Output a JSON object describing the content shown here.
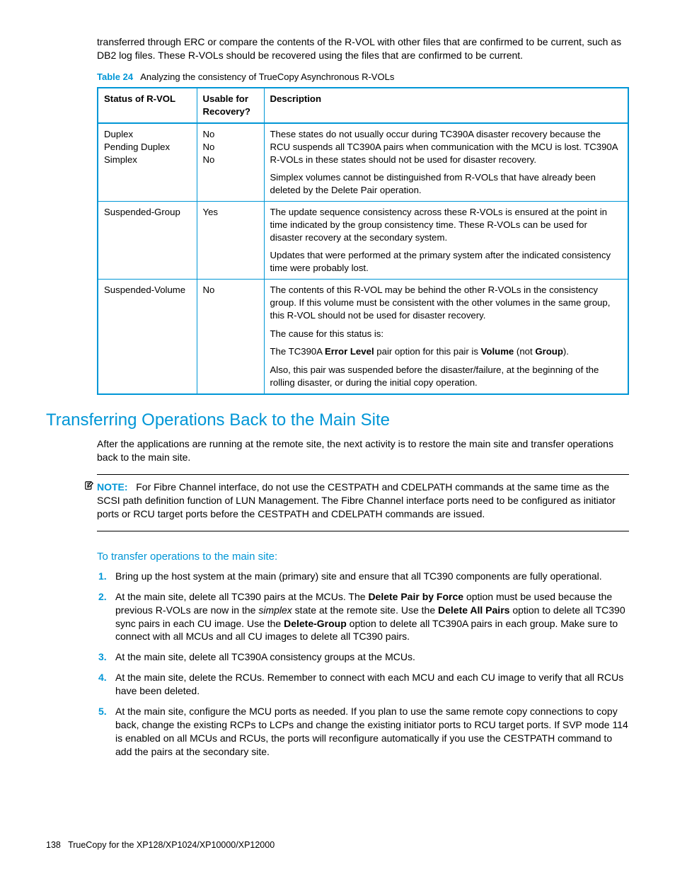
{
  "intro": "transferred through ERC or compare the contents of the R-VOL with other files that are confirmed to be current, such as DB2 log files. These R-VOLs should be recovered using the files that are confirmed to be current.",
  "table": {
    "caption_label": "Table 24",
    "caption_text": "Analyzing the consistency of TrueCopy Asynchronous R-VOLs",
    "headers": {
      "c1": "Status of R-VOL",
      "c2": "Usable for Recovery?",
      "c3": "Description"
    },
    "rows": [
      {
        "status": "Duplex\nPending Duplex\nSimplex",
        "usable": "No\nNo\nNo",
        "desc": [
          "These states do not usually occur during TC390A disaster recovery because the RCU suspends all TC390A pairs when communication with the MCU is lost. TC390A R-VOLs in these states should not be used for disaster recovery.",
          "Simplex volumes cannot be distinguished from R-VOLs that have already been deleted by the Delete Pair operation."
        ]
      },
      {
        "status": "Suspended-Group",
        "usable": "Yes",
        "desc": [
          "The update sequence consistency across these R-VOLs is ensured at the point in time indicated by the group consistency time. These R-VOLs can be used for disaster recovery at the secondary system.",
          "Updates that were performed at the primary system after the indicated consistency time were probably lost."
        ]
      },
      {
        "status": "Suspended-Volume",
        "usable": "No",
        "desc": [
          "The contents of this R-VOL may be behind the other R-VOLs in the consistency group. If this volume must be consistent with the other volumes in the same group, this R-VOL should not be used for disaster recovery.",
          "The cause for this status is:",
          "The TC390A <b>Error Level</b> pair option for this pair is <b>Volume</b> (not <b>Group</b>).",
          "Also, this pair was suspended before the disaster/failure, at the beginning of the rolling disaster, or during the initial copy operation."
        ]
      }
    ]
  },
  "section_heading": "Transferring Operations Back to the Main Site",
  "section_para": "After the applications are running at the remote site, the next activity is to restore the main site and transfer operations back to the main site.",
  "note": {
    "label": "NOTE:",
    "text": "For Fibre Channel interface, do not use the CESTPATH and CDELPATH commands at the same time as the SCSI path definition function of LUN Management. The Fibre Channel interface ports need to be configured as initiator ports or RCU target ports before the CESTPATH and CDELPATH commands are issued."
  },
  "subhead": "To transfer operations to the main site:",
  "steps": [
    "Bring up the host system at the main (primary) site and ensure that all TC390 components are fully operational.",
    "At the main site, delete all TC390 pairs at the MCUs. The <b>Delete Pair by Force</b> option must be used because the previous R-VOLs are now in the <em>simplex</em> state at the remote site. Use the <b>Delete All Pairs</b> option to delete all TC390 sync pairs in each CU image. Use the <b>Delete-Group</b> option to delete all TC390A pairs in each group. Make sure to connect with all MCUs and all CU images to delete all TC390 pairs.",
    "At the main site, delete all TC390A consistency groups at the MCUs.",
    "At the main site, delete the RCUs. Remember to connect with each MCU and each CU image to verify that all RCUs have been deleted.",
    "At the main site, configure the MCU ports as needed. If you plan to use the same remote copy connections to copy back, change the existing RCPs to LCPs and change the existing initiator ports to RCU target ports. If SVP mode 114 is enabled on all MCUs and RCUs, the ports will reconfigure automatically if you use the CESTPATH command to add the pairs at the secondary site."
  ],
  "footer": {
    "page": "138",
    "title": "TrueCopy for the XP128/XP1024/XP10000/XP12000"
  }
}
